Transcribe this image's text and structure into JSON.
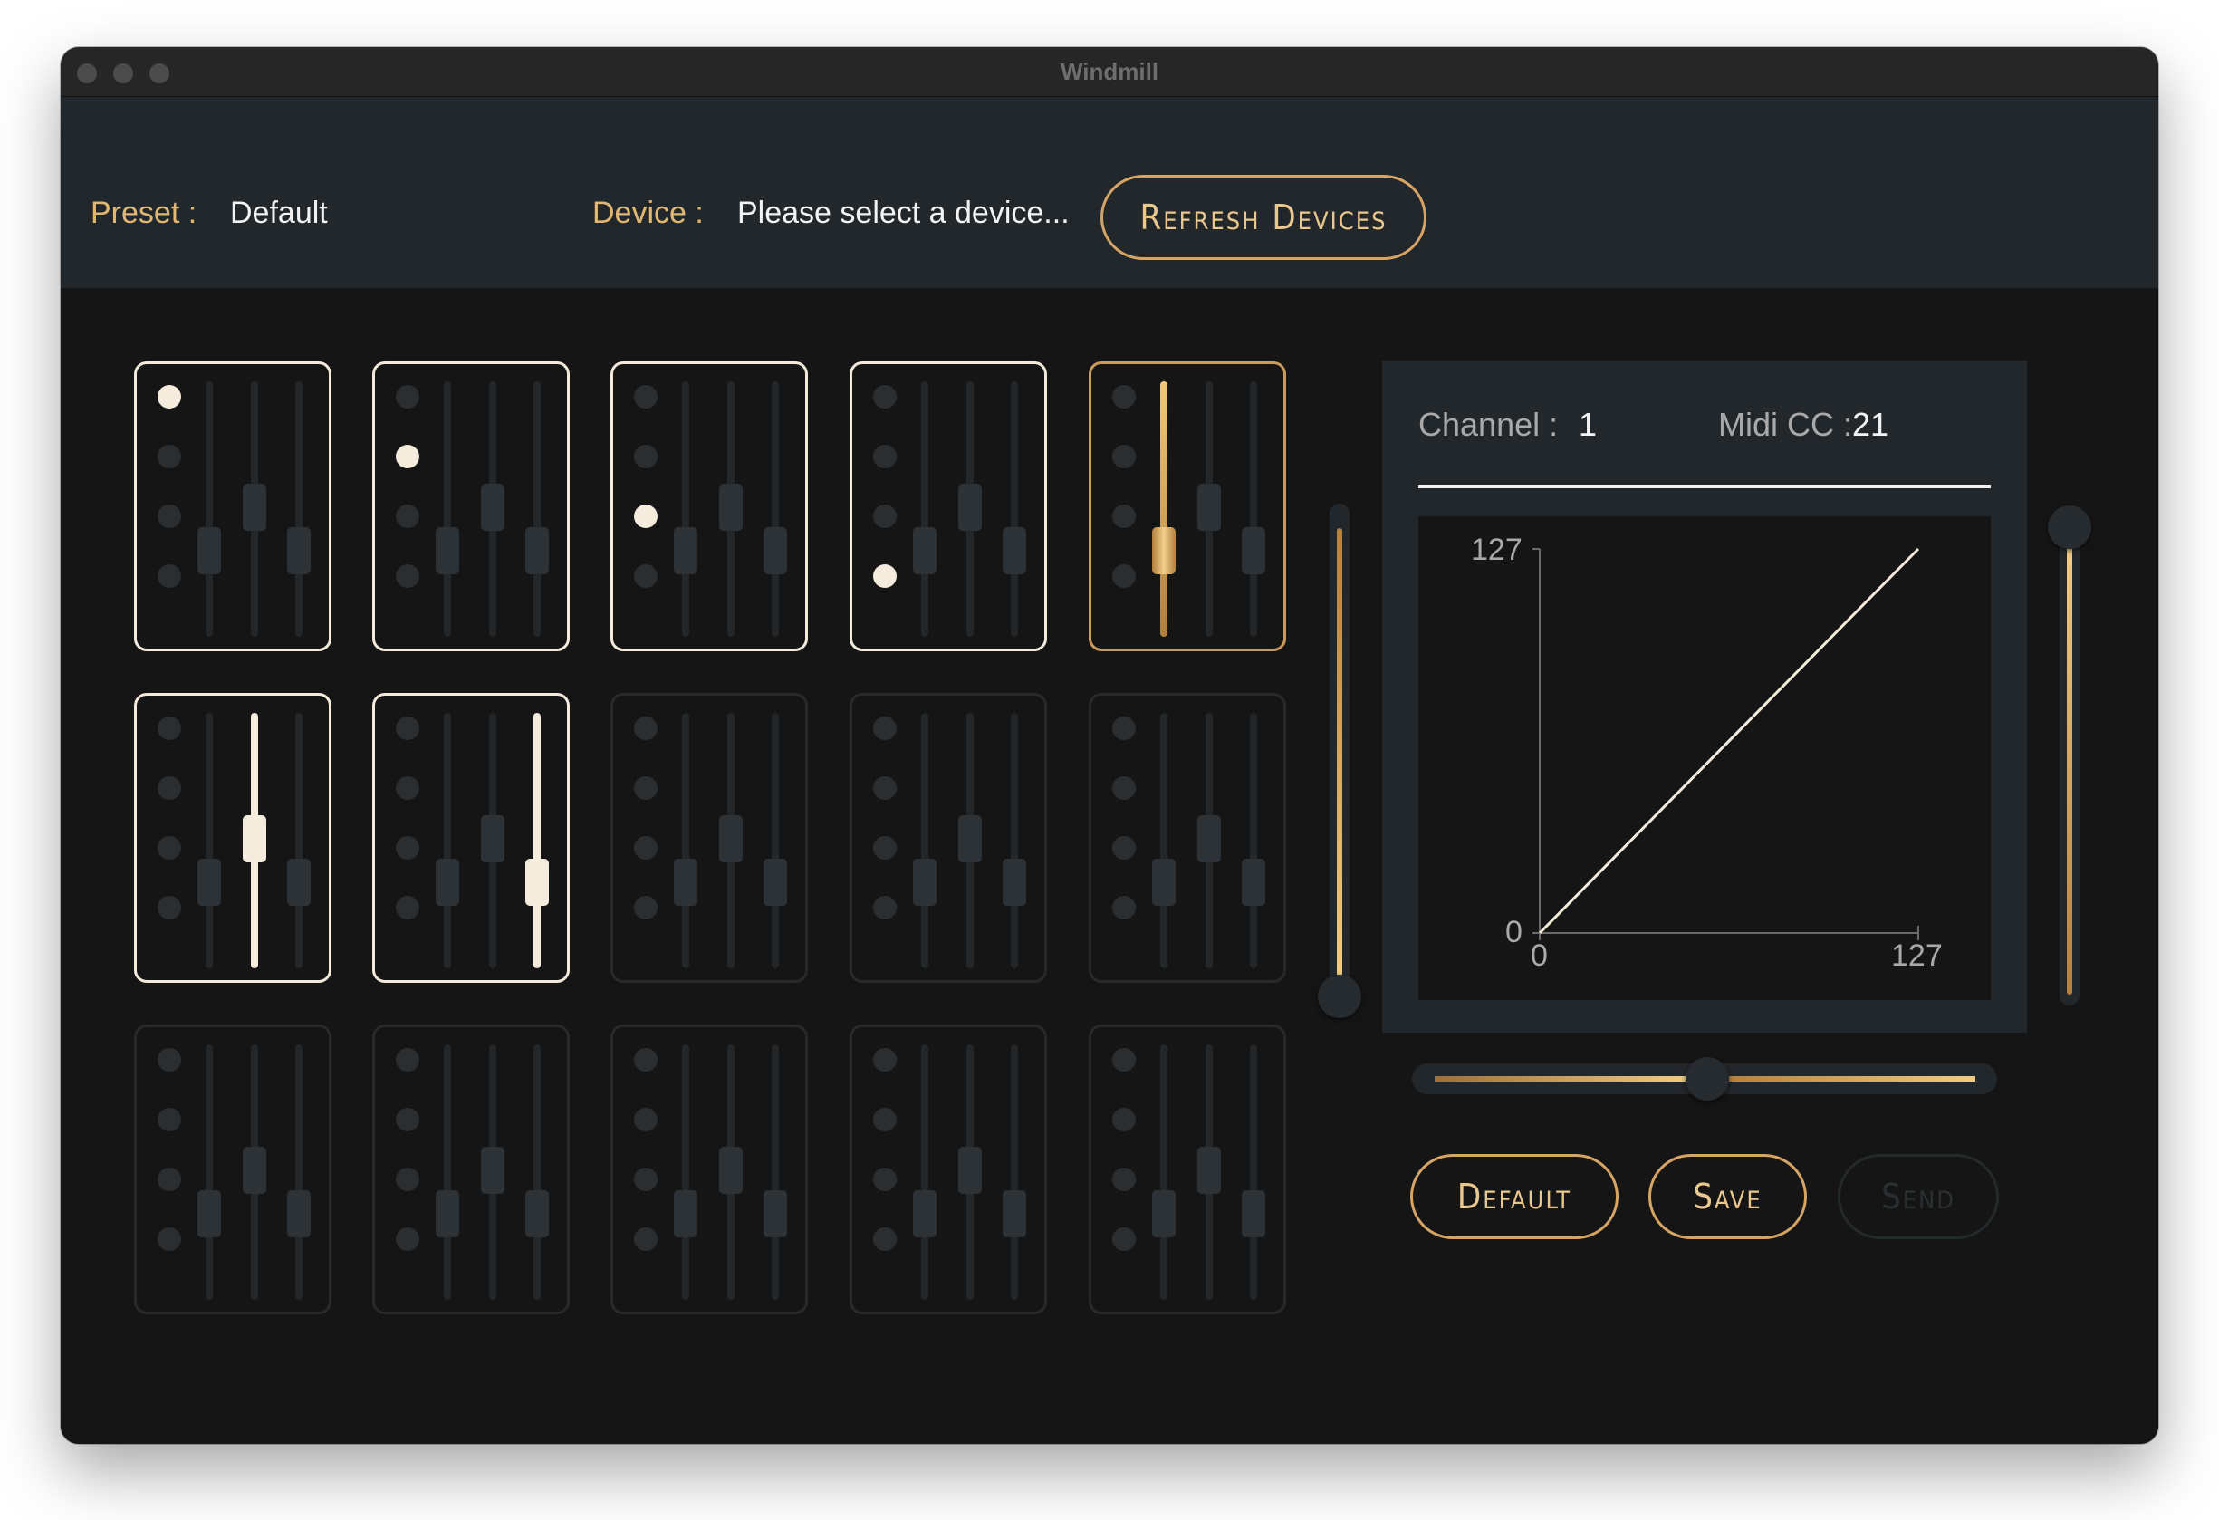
{
  "window": {
    "title": "Windmill"
  },
  "header": {
    "preset_label": "Preset :",
    "preset_value": "Default",
    "device_label": "Device :",
    "device_value": "Please select a device...",
    "refresh_button": "Refresh Devices"
  },
  "editor": {
    "channel_label": "Channel :",
    "channel_value": "1",
    "midi_cc_label": "Midi CC :",
    "midi_cc_value": "21",
    "graph": {
      "y_max_label": "127",
      "y_min_label": "0",
      "x_min_label": "0",
      "x_max_label": "127",
      "curve": "linear",
      "points": [
        [
          0,
          0
        ],
        [
          127,
          127
        ]
      ]
    },
    "curve_slider_value": 0.5,
    "left_slider_value": 0.1,
    "right_slider_value": 0.97,
    "buttons": {
      "default": "Default",
      "save": "Save",
      "send": "Send"
    }
  },
  "pads": [
    {
      "row": 1,
      "col": 1,
      "state": "selected",
      "active": "dot1"
    },
    {
      "row": 1,
      "col": 2,
      "state": "selected",
      "active": "dot2"
    },
    {
      "row": 1,
      "col": 3,
      "state": "selected",
      "active": "dot3"
    },
    {
      "row": 1,
      "col": 4,
      "state": "selected",
      "active": "dot4"
    },
    {
      "row": 1,
      "col": 5,
      "state": "current",
      "active": "fader1"
    },
    {
      "row": 2,
      "col": 1,
      "state": "selected",
      "active": "fader2"
    },
    {
      "row": 2,
      "col": 2,
      "state": "selected",
      "active": "fader3"
    },
    {
      "row": 2,
      "col": 3,
      "state": "inactive",
      "active": ""
    },
    {
      "row": 2,
      "col": 4,
      "state": "inactive",
      "active": ""
    },
    {
      "row": 2,
      "col": 5,
      "state": "inactive",
      "active": ""
    },
    {
      "row": 3,
      "col": 1,
      "state": "inactive",
      "active": ""
    },
    {
      "row": 3,
      "col": 2,
      "state": "inactive",
      "active": ""
    },
    {
      "row": 3,
      "col": 3,
      "state": "inactive",
      "active": ""
    },
    {
      "row": 3,
      "col": 4,
      "state": "inactive",
      "active": ""
    },
    {
      "row": 3,
      "col": 5,
      "state": "inactive",
      "active": ""
    }
  ],
  "colors": {
    "accent_gold": "#d6a565",
    "selected_white": "#f5ecde",
    "panel_bg": "#22272b",
    "bg": "#151515"
  }
}
